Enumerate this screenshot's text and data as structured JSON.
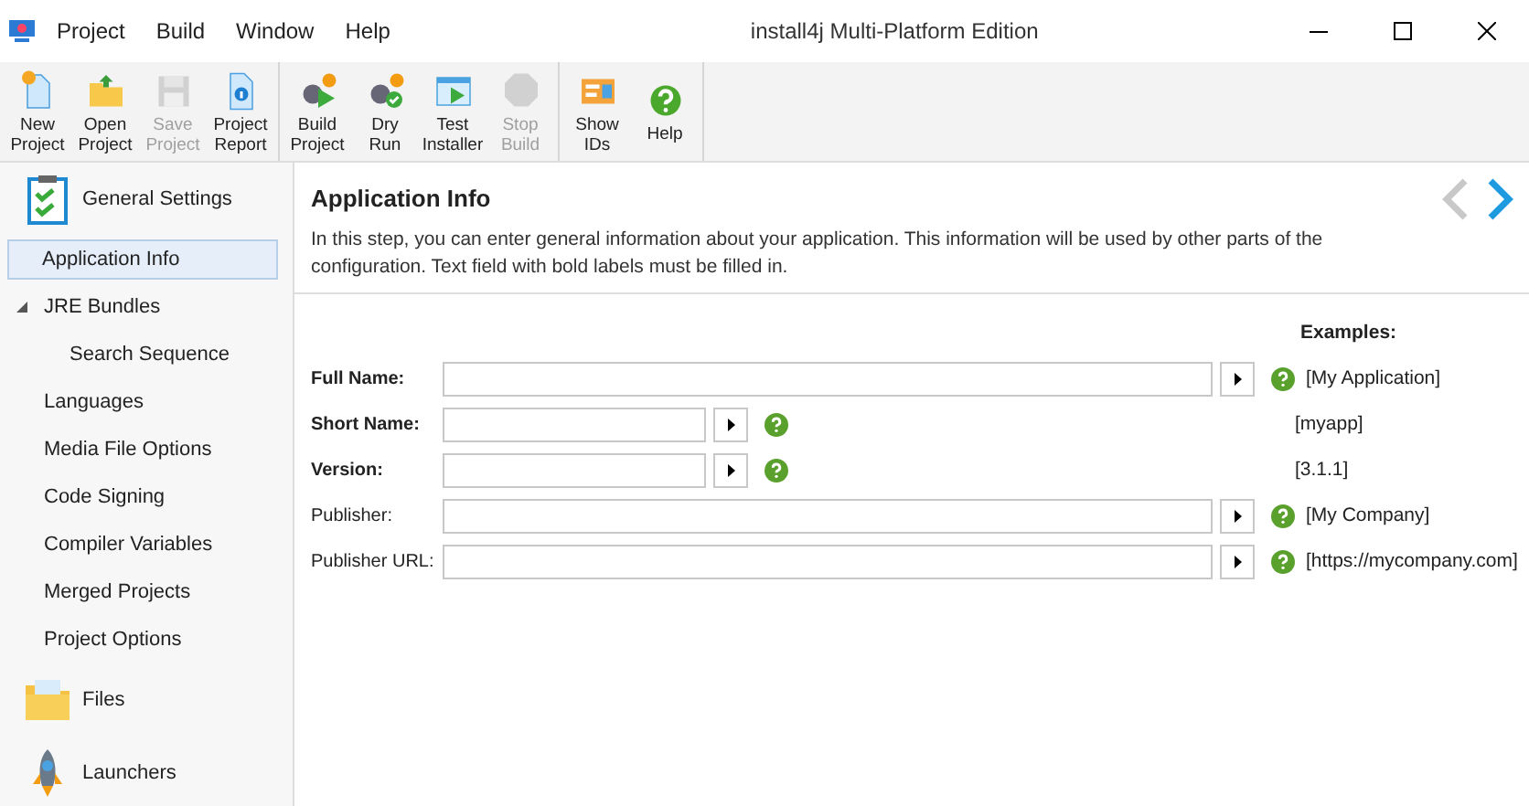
{
  "window": {
    "title": "install4j Multi-Platform Edition"
  },
  "menu": [
    "Project",
    "Build",
    "Window",
    "Help"
  ],
  "toolbar": [
    [
      {
        "label": "New\nProject",
        "disabled": false
      },
      {
        "label": "Open\nProject",
        "disabled": false
      },
      {
        "label": "Save\nProject",
        "disabled": true
      },
      {
        "label": "Project\nReport",
        "disabled": false
      }
    ],
    [
      {
        "label": "Build\nProject",
        "disabled": false
      },
      {
        "label": "Dry\nRun",
        "disabled": false
      },
      {
        "label": "Test\nInstaller",
        "disabled": false
      },
      {
        "label": "Stop\nBuild",
        "disabled": true
      }
    ],
    [
      {
        "label": "Show\nIDs",
        "disabled": false
      },
      {
        "label": "Help",
        "disabled": false
      }
    ]
  ],
  "sidebar": {
    "sections": [
      {
        "title": "General Settings",
        "items": [
          {
            "label": "Application Info",
            "selected": true
          },
          {
            "label": "JRE Bundles",
            "selected": false,
            "expanded": true,
            "children": [
              {
                "label": "Search Sequence",
                "selected": false
              }
            ]
          },
          {
            "label": "Languages",
            "selected": false
          },
          {
            "label": "Media File Options",
            "selected": false
          },
          {
            "label": "Code Signing",
            "selected": false
          },
          {
            "label": "Compiler Variables",
            "selected": false
          },
          {
            "label": "Merged Projects",
            "selected": false
          },
          {
            "label": "Project Options",
            "selected": false
          }
        ]
      },
      {
        "title": "Files"
      },
      {
        "title": "Launchers"
      }
    ]
  },
  "page": {
    "title": "Application Info",
    "back_disabled": true,
    "forward_disabled": false,
    "description": "In this step, you can enter general information about your application. This information will be used by other parts of the configuration. Text field with bold labels must be filled in.",
    "examples_heading": "Examples:",
    "fields": [
      {
        "label": "Full Name:",
        "required": true,
        "kind": "long",
        "example": "[My Application]"
      },
      {
        "label": "Short Name:",
        "required": true,
        "kind": "short",
        "example": "[myapp]"
      },
      {
        "label": "Version:",
        "required": true,
        "kind": "short",
        "example": "[3.1.1]"
      },
      {
        "label": "Publisher:",
        "required": false,
        "kind": "long",
        "example": "[My Company]"
      },
      {
        "label": "Publisher URL:",
        "required": false,
        "kind": "long",
        "example": "[https://mycompany.com]"
      }
    ]
  }
}
